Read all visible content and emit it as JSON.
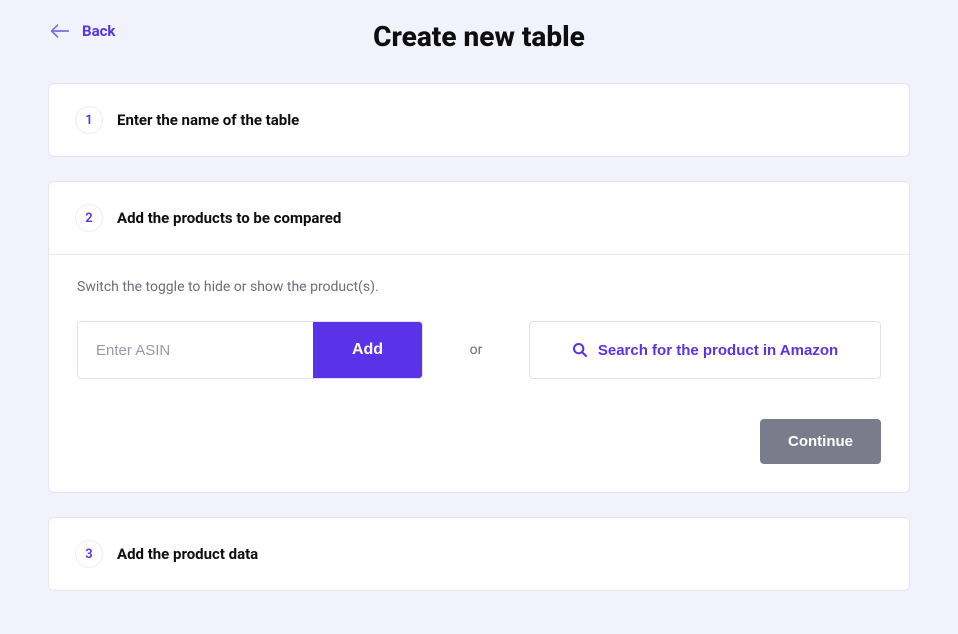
{
  "header": {
    "back_label": "Back",
    "title": "Create new table"
  },
  "steps": {
    "s1": {
      "num": "1",
      "title": "Enter the name of the table"
    },
    "s2": {
      "num": "2",
      "title": "Add the products to be compared",
      "hint": "Switch the toggle to hide or show the product(s).",
      "asin_placeholder": "Enter ASIN",
      "add_label": "Add",
      "or_label": "or",
      "search_label": "Search for the product in Amazon",
      "continue_label": "Continue"
    },
    "s3": {
      "num": "3",
      "title": "Add the product data"
    }
  }
}
